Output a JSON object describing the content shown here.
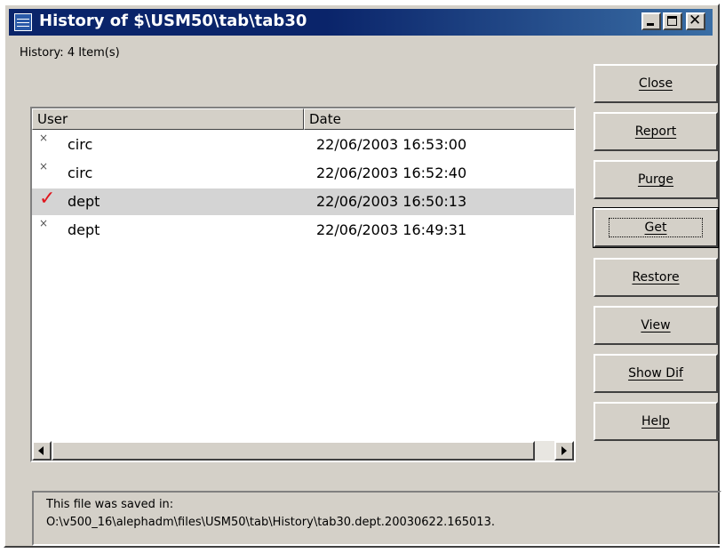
{
  "window": {
    "title": "History of $\\USM50\\tab\\tab30",
    "close_glyph": "✕"
  },
  "history_count": "History: 4 Item(s)",
  "list": {
    "columns": [
      "User",
      "Date"
    ],
    "rows": [
      {
        "mark": "×",
        "user": "circ",
        "date": "22/06/2003 16:53:00"
      },
      {
        "mark": "×",
        "user": "circ",
        "date": "22/06/2003 16:52:40"
      },
      {
        "mark": "✓",
        "user": "dept",
        "date": "22/06/2003 16:50:13",
        "selected": true
      },
      {
        "mark": "×",
        "user": "dept",
        "date": "22/06/2003 16:49:31"
      }
    ]
  },
  "buttons": {
    "close": "Close",
    "report": "Report",
    "purge": "Purge",
    "get": "Get",
    "restore": "Restore",
    "view": "View",
    "show_dif": "Show Dif",
    "help": "Help"
  },
  "status": {
    "line1": "This file was saved in:",
    "line2": "O:\\v500_16\\alephadm\\files\\USM50\\tab\\History\\tab30.dept.20030622.165013."
  },
  "colors": {
    "title_bar": "#0a246a",
    "selected_row": "#d4d4d4",
    "check_mark": "#e0161e"
  }
}
